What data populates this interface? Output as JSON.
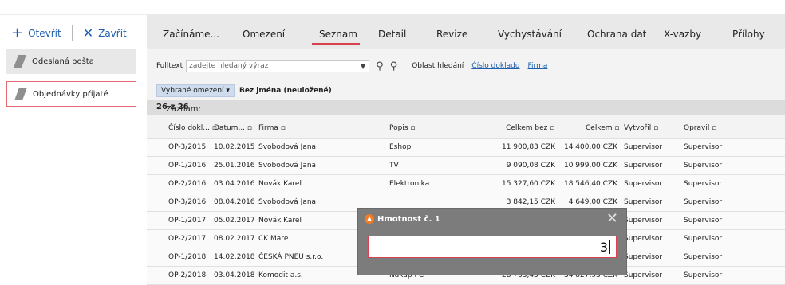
{
  "left": {
    "open_label": "Otevřít",
    "close_label": "Zavřít",
    "items": [
      {
        "label": "Odeslaná pošta"
      },
      {
        "label": "Objednávky přijaté"
      }
    ]
  },
  "tabs": [
    {
      "label": "Začínáme..."
    },
    {
      "label": "Omezení"
    },
    {
      "label": "Seznam"
    },
    {
      "label": "Detail"
    },
    {
      "label": "Revize"
    },
    {
      "label": "Vychystávání"
    },
    {
      "label": "Ochrana dat"
    },
    {
      "label": "X-vazby"
    },
    {
      "label": "Přílohy"
    }
  ],
  "filter": {
    "label": "Fulltext",
    "placeholder": "zadejte hledaný výraz",
    "oblast": "Oblast hledání",
    "link1": "Číslo dokladu",
    "link2": "Firma"
  },
  "vybrane": {
    "button": "Vybrané omezení",
    "name": "Bez jména (neuložené)"
  },
  "zaznam": {
    "label": "Záznam: ",
    "count": "26 z 26"
  },
  "table": {
    "headers": [
      "Číslo dokl...",
      "Datum...",
      "Firma",
      "Popis",
      "Celkem bez",
      "Celkem",
      "Vytvořil",
      "Opravil"
    ],
    "rows": [
      [
        "OP-3/2015",
        "10.02.2015",
        "Svobodová Jana",
        "Eshop",
        "11 900,83 CZK",
        "14 400,00 CZK",
        "Supervisor",
        "Supervisor"
      ],
      [
        "OP-1/2016",
        "25.01.2016",
        "Svobodová Jana",
        "TV",
        "9 090,08 CZK",
        "10 999,00 CZK",
        "Supervisor",
        "Supervisor"
      ],
      [
        "OP-2/2016",
        "03.04.2016",
        "Novák Karel",
        "Elektronika",
        "15 327,60 CZK",
        "18 546,40 CZK",
        "Supervisor",
        "Supervisor"
      ],
      [
        "OP-3/2016",
        "08.04.2016",
        "Svobodová Jana",
        "",
        "3 842,15 CZK",
        "4 649,00 CZK",
        "Supervisor",
        "Supervisor"
      ],
      [
        "OP-1/2017",
        "05.02.2017",
        "Novák Karel",
        "",
        "",
        "",
        "Supervisor",
        "Supervisor"
      ],
      [
        "OP-2/2017",
        "08.02.2017",
        "CK Mare",
        "",
        "",
        "",
        "Supervisor",
        "Supervisor"
      ],
      [
        "OP-1/2018",
        "14.02.2018",
        "ČESKÁ PNEU s.r.o.",
        "",
        "",
        "",
        "Supervisor",
        "Supervisor"
      ],
      [
        "OP-2/2018",
        "03.04.2018",
        "Komodit a.s.",
        "Nákup PC",
        "28 763,43 CZK",
        "34 827,93 CZK",
        "Supervisor",
        "Supervisor"
      ]
    ]
  },
  "dialog": {
    "title": "Hmotnost č. 1",
    "value": "3"
  },
  "colors": {
    "accent_blue": "#1f5fb0",
    "accent_red": "#d8414d",
    "dialog_bg": "#7c7c7c"
  }
}
